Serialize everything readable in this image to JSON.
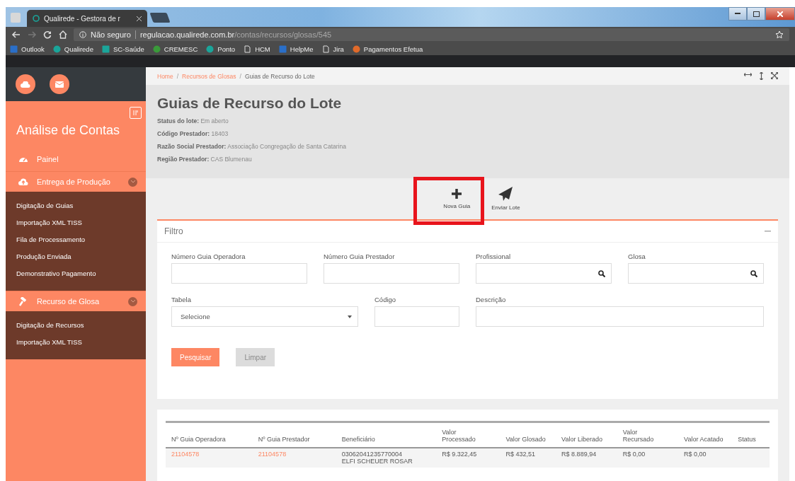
{
  "browser": {
    "tab_title": "Qualirede - Gestora de r",
    "security": "Não seguro",
    "url_host": "regulacao.qualirede.com.br",
    "url_path": "/contas/recursos/glosas/545",
    "bookmarks": [
      "Outlook",
      "Qualirede",
      "SC-Saúde",
      "CREMESC",
      "Ponto",
      "HCM",
      "HelpMe",
      "Jira",
      "Pagamentos Efetua"
    ]
  },
  "sidebar": {
    "title": "Análise de Contas",
    "items": [
      {
        "label": "Painel"
      },
      {
        "label": "Entrega de Produção",
        "expanded": true,
        "children": [
          {
            "label": "Digitação de Guias"
          },
          {
            "label": "Importação XML TISS"
          },
          {
            "label": "Fila de Processamento"
          },
          {
            "label": "Produção Enviada"
          },
          {
            "label": "Demonstrativo Pagamento"
          }
        ]
      },
      {
        "label": "Recurso de Glosa",
        "expanded": true,
        "children": [
          {
            "label": "Digitação de Recursos"
          },
          {
            "label": "Importação XML TISS"
          }
        ]
      }
    ]
  },
  "breadcrumb": {
    "separator": "/",
    "items": [
      {
        "label": "Home",
        "current": false
      },
      {
        "label": "Recursos de Glosas",
        "current": false
      },
      {
        "label": "Guias de Recurso do Lote",
        "current": true
      }
    ]
  },
  "header": {
    "title": "Guias de Recurso do Lote",
    "info": [
      {
        "label": "Status do lote:",
        "value": "Em aberto"
      },
      {
        "label": "Código Prestador:",
        "value": "18403"
      },
      {
        "label": "Razão Social Prestador:",
        "value": "Associação Congregação de Santa Catarina"
      },
      {
        "label": "Região Prestador:",
        "value": "CAS Blumenau"
      }
    ]
  },
  "toolbar": [
    {
      "label": "Nova Guia",
      "kind": "add",
      "highlighted": true
    },
    {
      "label": "Enviar Lote",
      "kind": "send",
      "highlighted": false
    }
  ],
  "filter": {
    "title": "Filtro",
    "fields": [
      {
        "label": "Número Guia Operadora",
        "kind": "text"
      },
      {
        "label": "Número Guia Prestador",
        "kind": "text"
      },
      {
        "label": "Profissional",
        "kind": "search"
      },
      {
        "label": "Glosa",
        "kind": "search"
      },
      {
        "label": "Tabela",
        "kind": "select",
        "value": "Selecione"
      },
      {
        "label": "Código",
        "kind": "text"
      },
      {
        "label": "Descrição",
        "kind": "text"
      }
    ],
    "buttons": [
      {
        "label": "Pesquisar",
        "disabled": false
      },
      {
        "label": "Limpar",
        "disabled": true
      }
    ]
  },
  "table": {
    "columns": [
      "Nº Guia Operadora",
      "Nº Guia Prestador",
      "Beneficiário",
      "Valor Processado",
      "Valor Glosado",
      "Valor Liberado",
      "Valor Recursado",
      "Valor Acatado",
      "Status"
    ],
    "rows": [
      {
        "guia_operadora": "21104578",
        "guia_prestador": "21104578",
        "beneficiario_codigo": "03062041235770004",
        "beneficiario_nome": "ELFI SCHEUER ROSAR",
        "valor_processado": "R$ 9.322,45",
        "valor_glosado": "R$ 432,51",
        "valor_liberado": "R$ 8.889,94",
        "valor_recursado": "R$ 0,00",
        "valor_acatado": "R$ 0,00"
      }
    ]
  }
}
